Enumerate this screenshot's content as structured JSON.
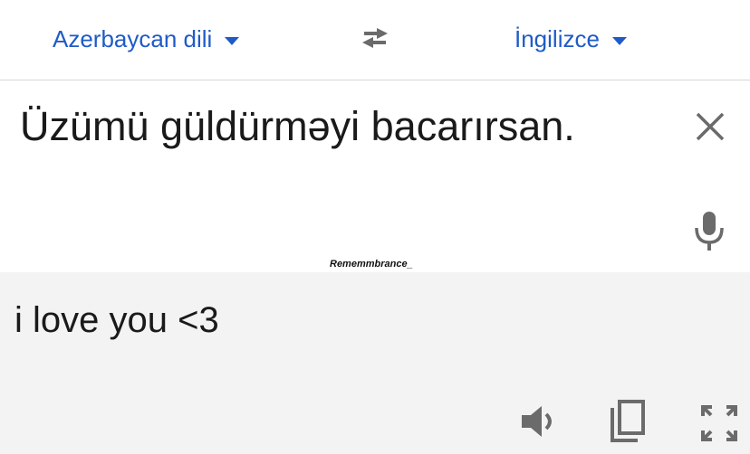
{
  "languages": {
    "source": "Azerbaycan dili",
    "target": "İngilizce"
  },
  "input": {
    "text": "Üzümü güldürməyi bacarırsan."
  },
  "watermark": "Rememmbrance_",
  "output": {
    "text": "i love you <3"
  },
  "icons": {
    "swap": "swap-arrows-icon",
    "clear": "close-icon",
    "mic": "microphone-icon",
    "speak": "speaker-icon",
    "copy": "copy-icon",
    "fullscreen": "fullscreen-icon"
  },
  "colors": {
    "accent": "#1f5bc7",
    "icon": "#6b6b6b",
    "output_bg": "#f3f3f3"
  }
}
